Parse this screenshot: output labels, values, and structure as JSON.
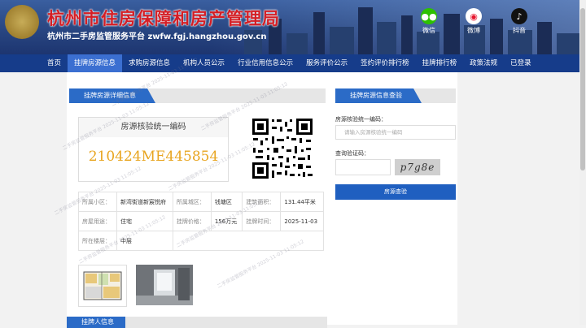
{
  "header": {
    "title": "杭州市住房保障和房产管理局",
    "subtitle": "杭州市二手房监管服务平台 zwfw.fgj.hangzhou.gov.cn",
    "social": [
      {
        "label": "微信",
        "icon": "wechat-icon",
        "color": "#2dc100"
      },
      {
        "label": "微博",
        "icon": "weibo-icon",
        "color": "#e6162d"
      },
      {
        "label": "抖音",
        "icon": "douyin-icon",
        "color": "#111111"
      }
    ]
  },
  "nav": {
    "items": [
      "首页",
      "挂牌房源信息",
      "求购房源信息",
      "机构人员公示",
      "行业信用信息公示",
      "服务评价公示",
      "签约评价排行榜",
      "挂牌排行榜",
      "政策法规",
      "已登录"
    ],
    "active_index": 1
  },
  "listing": {
    "section_title": "挂牌房源详细信息",
    "code_caption": "房源核验统一编码",
    "code_value": "210424ME445854",
    "fields": {
      "community_label": "所属小区：",
      "community_value": "新湾街道新宸悦府",
      "district_label": "所属城区：",
      "district_value": "钱塘区",
      "area_label": "建筑面积：",
      "area_value": "131.44平米",
      "usage_label": "房屋用途：",
      "usage_value": "住宅",
      "price_label": "挂牌价格：",
      "price_value": "156万元",
      "time_label": "挂牌时间：",
      "time_value": "2025-11-03",
      "floor_label": "所在楼层：",
      "floor_value": "中层"
    }
  },
  "verify": {
    "section_title": "挂牌房源信息查验",
    "code_label": "房源核验统一编码：",
    "code_placeholder": "请输入房源核验统一编码",
    "captcha_label": "查询验证码：",
    "captcha_text": "p7g8e",
    "button_label": "房源查验"
  },
  "agent": {
    "section_title": "挂牌人信息"
  },
  "watermark": {
    "text": "二手房监管服务平台 2025-11-03 11:05:12"
  },
  "colors": {
    "nav_bg": "#163c8a",
    "nav_active": "#3b6fd1",
    "tab_blue": "#2b6bc7",
    "title_red": "#d41e25",
    "code_orange": "#e8a520"
  }
}
